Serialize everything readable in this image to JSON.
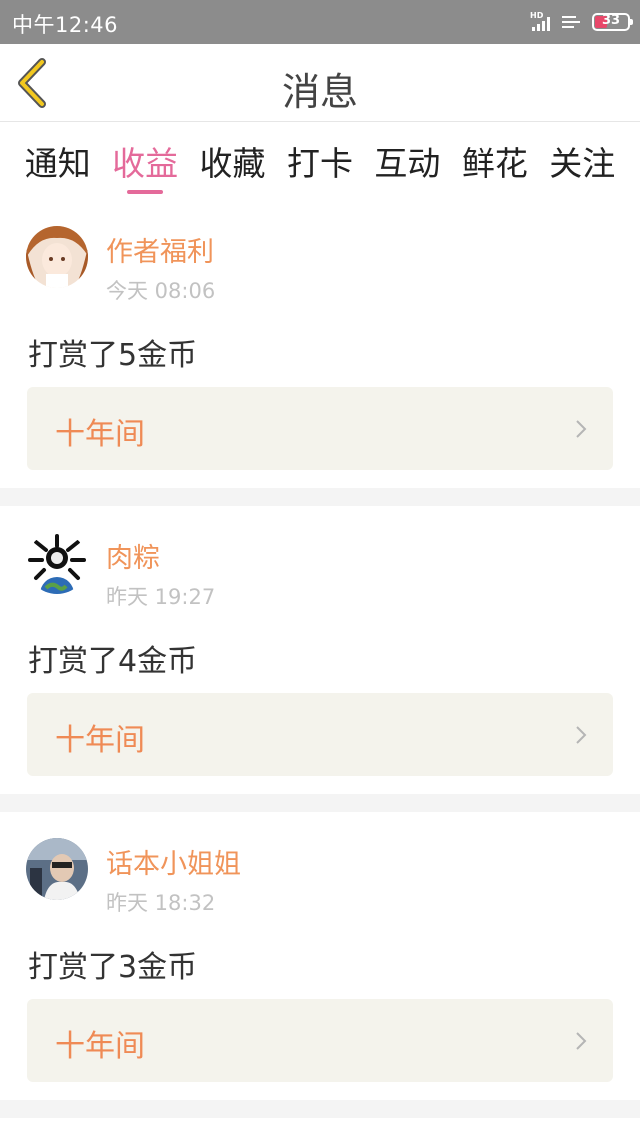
{
  "status_bar": {
    "time": "中午12:46",
    "signal_label": "HD",
    "battery": "33",
    "battery_color": "#e8486a"
  },
  "header": {
    "title": "消息",
    "back_icon": "chevron-left-icon"
  },
  "tabs": [
    {
      "label": "通知",
      "active": false
    },
    {
      "label": "收益",
      "active": true
    },
    {
      "label": "收藏",
      "active": false
    },
    {
      "label": "打卡",
      "active": false
    },
    {
      "label": "互动",
      "active": false
    },
    {
      "label": "鲜花",
      "active": false
    },
    {
      "label": "关注",
      "active": false
    }
  ],
  "accent_color": "#e46a9a",
  "name_color": "#f0945a",
  "messages": [
    {
      "user": "作者福利",
      "time": "今天 08:06",
      "text": "打赏了5金币",
      "book": "十年间"
    },
    {
      "user": "肉粽",
      "time": "昨天 19:27",
      "text": "打赏了4金币",
      "book": "十年间"
    },
    {
      "user": "话本小姐姐",
      "time": "昨天 18:32",
      "text": "打赏了3金币",
      "book": "十年间"
    }
  ]
}
